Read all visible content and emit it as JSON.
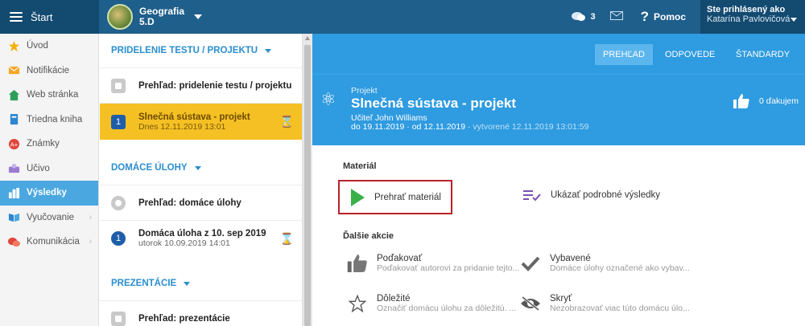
{
  "topbar": {
    "start_label": "Štart",
    "class_name": "Geografia",
    "class_sub": "5.D",
    "chat_count": "3",
    "help_label": "Pomoc",
    "user_line1": "Ste prihlásený ako",
    "user_line2": "Katarína Pavlovičová"
  },
  "sidebar": {
    "items": [
      {
        "label": "Úvod"
      },
      {
        "label": "Notifikácie"
      },
      {
        "label": "Web stránka"
      },
      {
        "label": "Triedna kniha"
      },
      {
        "label": "Známky"
      },
      {
        "label": "Učivo"
      },
      {
        "label": "Výsledky"
      },
      {
        "label": "Vyučovanie"
      },
      {
        "label": "Komunikácia"
      }
    ]
  },
  "middle": {
    "section1": "PRIDELENIE TESTU / PROJEKTU",
    "item1_title": "Prehľad: pridelenie testu / projektu",
    "item2_num": "1",
    "item2_title": "Slnečná sústava - projekt",
    "item2_sub": "Dnes 12.11.2019 13:01",
    "section2": "DOMÁCE ÚLOHY",
    "item3_title": "Prehľad: domáce úlohy",
    "item4_num": "1",
    "item4_title": "Domáca úloha z 10. sep 2019",
    "item4_sub": "utorok 10.09.2019 14:01",
    "section3": "PREZENTÁCIE",
    "item5_title": "Prehľad: prezentácie"
  },
  "tabs": [
    "PREHĽAD",
    "ODPOVEDE",
    "ŠTANDARDY"
  ],
  "header": {
    "type": "Projekt",
    "title": "Slnečná sústava - projekt",
    "teacher": "Učiteľ John Williams",
    "dates": "do 19.11.2019 · od 12.11.2019 ·",
    "created": "vytvorené 12.11.2019 13:01:59",
    "thanks": "0 ďakujem"
  },
  "body": {
    "material_label": "Materiál",
    "play_label": "Prehrať materiál",
    "results_label": "Ukázať podrobné výsledky",
    "further_label": "Ďalšie akcie",
    "actions": [
      {
        "title": "Poďakovať",
        "desc": "Poďakovať autorovi za pridanie tejto..."
      },
      {
        "title": "Vybavené",
        "desc": "Domáce úlohy označené ako vybav..."
      },
      {
        "title": "Dôležité",
        "desc": "Označiť domácu úlohu za dôležitú. ..."
      },
      {
        "title": "Skryť",
        "desc": "Nezobrazovať viac túto domácu úlo..."
      }
    ]
  },
  "colors": {
    "topbar": "#1f5f8b",
    "accent": "#2f9be0",
    "selected": "#f5c023",
    "highlight_border": "#b9232b"
  }
}
